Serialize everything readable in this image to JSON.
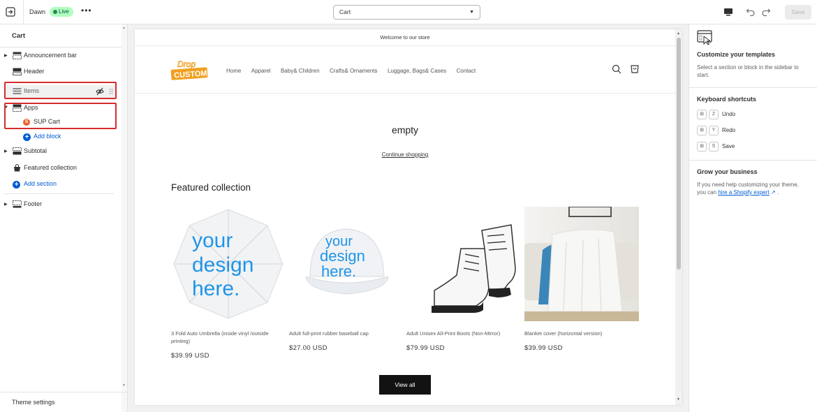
{
  "topbar": {
    "theme_name": "Dawn",
    "live_label": "Live",
    "more_label": "•••",
    "template_value": "Cart",
    "save_label": "Save"
  },
  "left": {
    "title": "Cart",
    "items": {
      "announcement": "Announcement bar",
      "header": "Header",
      "items": "Items",
      "apps": "Apps",
      "sup_cart": "SUP Cart",
      "add_block": "Add block",
      "subtotal": "Subtotal",
      "featured": "Featured collection",
      "add_section": "Add section",
      "footer": "Footer"
    },
    "theme_settings": "Theme settings"
  },
  "preview": {
    "announcement": "Welcome to our store",
    "logo_top": "Drop",
    "logo_bottom": "CUSTOM",
    "nav": [
      "Home",
      "Apparel",
      "Baby& Children",
      "Crafts& Ornaments",
      "Luggage, Bags& Cases",
      "Contact"
    ],
    "empty_text": "empty",
    "continue_label": "Continue shopping",
    "collection_title": "Featured collection",
    "design_text": [
      "your",
      "design",
      "here."
    ],
    "products": [
      {
        "name": "3 Fold Auto Umbrella (inside vinyl /outside printing)",
        "price": "$39.99 USD"
      },
      {
        "name": "Adult full-print rubber baseball cap",
        "price": "$27.00 USD"
      },
      {
        "name": "Adult Unisex All-Print Boots (Non-Mirror)",
        "price": "$79.99 USD"
      },
      {
        "name": "Blanket cover (horizontal version)",
        "price": "$39.99 USD"
      }
    ],
    "view_all_label": "View all"
  },
  "right": {
    "customize_title": "Customize your templates",
    "customize_text": "Select a section or block in the sidebar to start.",
    "shortcuts_title": "Keyboard shortcuts",
    "shortcuts": [
      {
        "key": "Z",
        "label": "Undo"
      },
      {
        "key": "Y",
        "label": "Redo"
      },
      {
        "key": "S",
        "label": "Save"
      }
    ],
    "grow_title": "Grow your business",
    "grow_text": "If you need help customizing your theme, you can",
    "grow_link": "hire a Shopify expert",
    "grow_end": "."
  }
}
